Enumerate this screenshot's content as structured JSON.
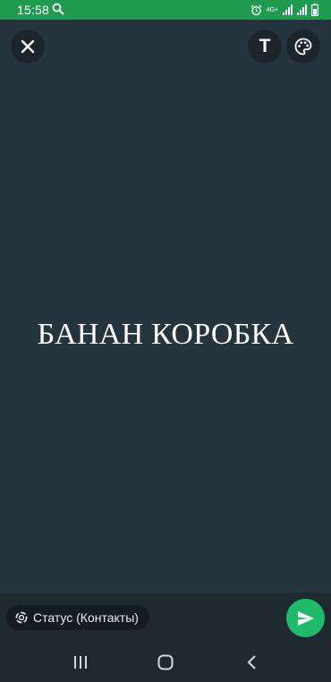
{
  "statusbar": {
    "time": "15:58",
    "network": "4G+",
    "icons": [
      "search-icon",
      "alarm-icon",
      "signal-icon",
      "signal-icon",
      "battery-icon"
    ]
  },
  "toolbar": {
    "close_icon": "close-icon",
    "text_icon_label": "T",
    "palette_icon": "palette-icon"
  },
  "status": {
    "text": "БАНАН КОРОБКА",
    "background_color": "#26353d"
  },
  "footer": {
    "audience_label": "Статус (Контакты)",
    "send_icon": "send-icon",
    "send_color": "#1ebb6b"
  },
  "navbar": {
    "buttons": [
      "recents-icon",
      "home-icon",
      "back-icon"
    ]
  }
}
